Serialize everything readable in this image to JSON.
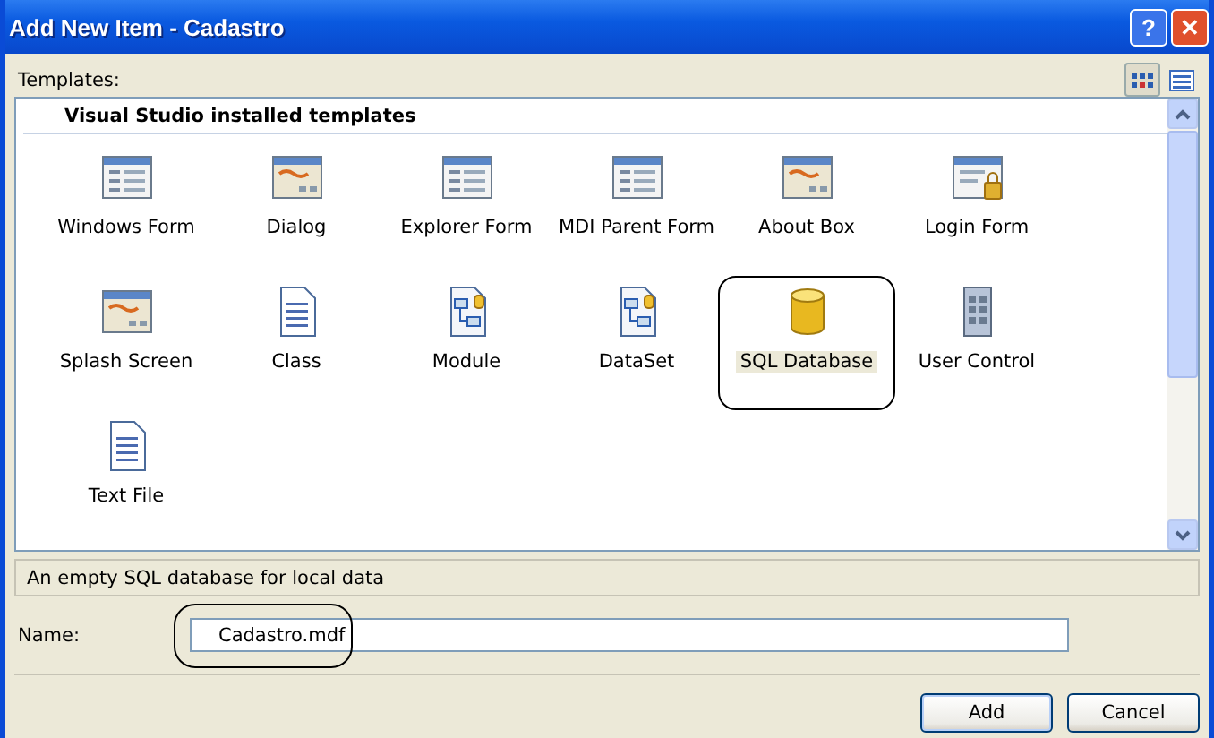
{
  "window": {
    "title": "Add New Item - Cadastro"
  },
  "title_buttons": [
    {
      "kind": "help",
      "label": "?"
    },
    {
      "kind": "close",
      "label": "✕"
    }
  ],
  "templates_label": "Templates:",
  "view_buttons": [
    {
      "kind": "large",
      "selected": true
    },
    {
      "kind": "small",
      "selected": false
    }
  ],
  "group_header": "Visual Studio installed templates",
  "templates": [
    {
      "label": "Windows Form",
      "kind": "form",
      "selected": false
    },
    {
      "label": "Dialog",
      "kind": "dialog",
      "selected": false
    },
    {
      "label": "Explorer Form",
      "kind": "form",
      "selected": false
    },
    {
      "label": "MDI Parent Form",
      "kind": "form",
      "selected": false
    },
    {
      "label": "About Box",
      "kind": "dialog",
      "selected": false
    },
    {
      "label": "Login Form",
      "kind": "login",
      "selected": false
    },
    {
      "label": "Splash Screen",
      "kind": "dialog",
      "selected": false
    },
    {
      "label": "Class",
      "kind": "document",
      "selected": false
    },
    {
      "label": "Module",
      "kind": "diagram",
      "selected": false
    },
    {
      "label": "DataSet",
      "kind": "diagram",
      "selected": false
    },
    {
      "label": "SQL Database",
      "kind": "database",
      "selected": true
    },
    {
      "label": "User Control",
      "kind": "control",
      "selected": false
    },
    {
      "label": "Text File",
      "kind": "document",
      "selected": false
    }
  ],
  "description": "An empty SQL database for local data",
  "name_field": {
    "label": "Name:",
    "value": "Cadastro.mdf",
    "highlighted": true
  },
  "buttons": [
    {
      "label": "Add",
      "default": true
    },
    {
      "label": "Cancel",
      "default": false
    }
  ]
}
